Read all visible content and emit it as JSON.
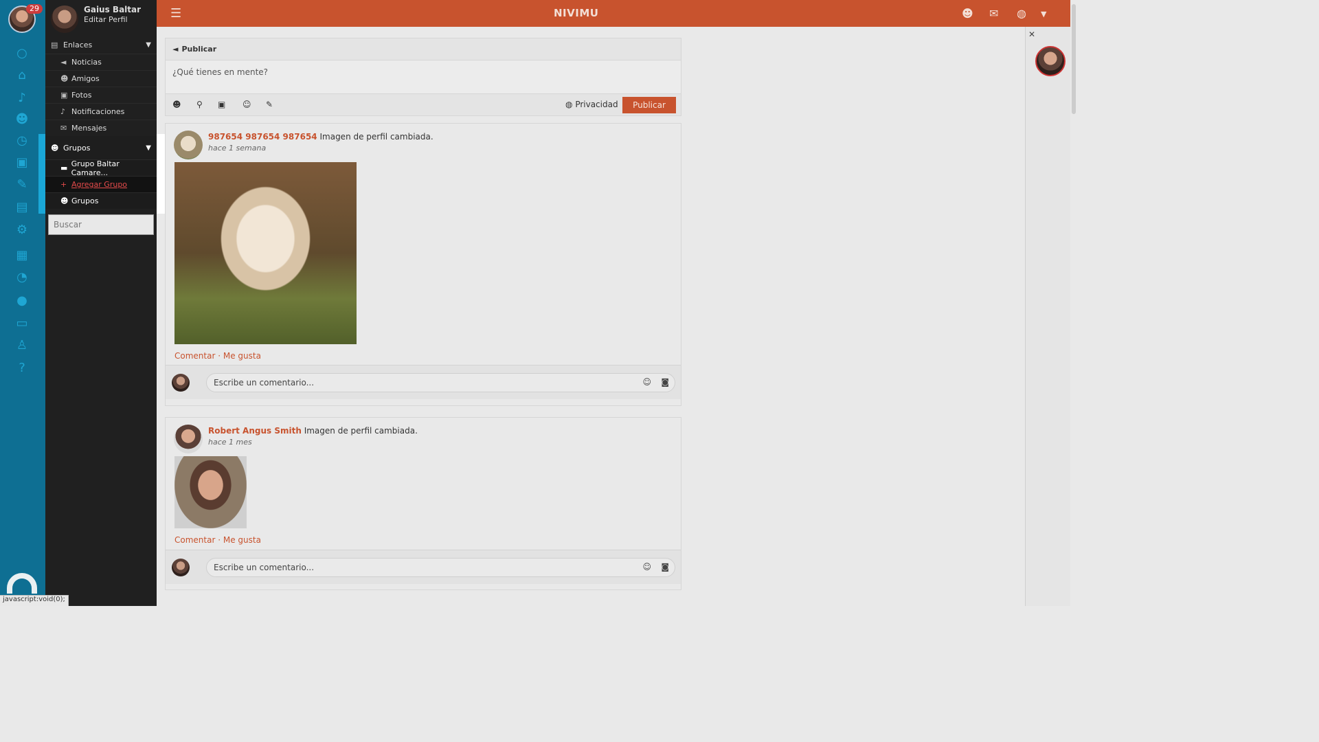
{
  "app": {
    "brand": "NIVIMU",
    "notifications_badge": "29"
  },
  "sidebar": {
    "profile_name": "Gaius Baltar",
    "profile_edit": "Editar Perfil",
    "links_section": "Enlaces",
    "links": [
      "Noticias",
      "Amigos",
      "Fotos",
      "Notificaciones",
      "Mensajes"
    ],
    "groups_section": "Grupos",
    "groups": {
      "item1": "Grupo Baltar Camare...",
      "add": "Agregar Grupo",
      "item2": "Grupos"
    },
    "search_placeholder": "Buscar"
  },
  "compose": {
    "header": "Publicar",
    "placeholder": "¿Qué tienes en mente?",
    "privacy": "Privacidad",
    "publish": "Publicar"
  },
  "posts": [
    {
      "author": "987654 987654 987654",
      "text": "Imagen de perfil cambiada.",
      "time": "hace 1 semana",
      "comment": "Comentar",
      "sep": "·",
      "like": "Me gusta",
      "comment_placeholder": "Escribe un comentario..."
    },
    {
      "author": "Robert Angus Smith",
      "text": "Imagen de perfil cambiada.",
      "time": "hace 1 mes",
      "comment": "Comentar",
      "sep": "·",
      "like": "Me gusta",
      "comment_placeholder": "Escribe un comentario..."
    }
  ],
  "statusbar": "javascript:void(0);",
  "colors": {
    "accent": "#c8532e",
    "rail": "#0e6f93",
    "sidebar": "#202020",
    "highlight": "#1aa7d7"
  }
}
